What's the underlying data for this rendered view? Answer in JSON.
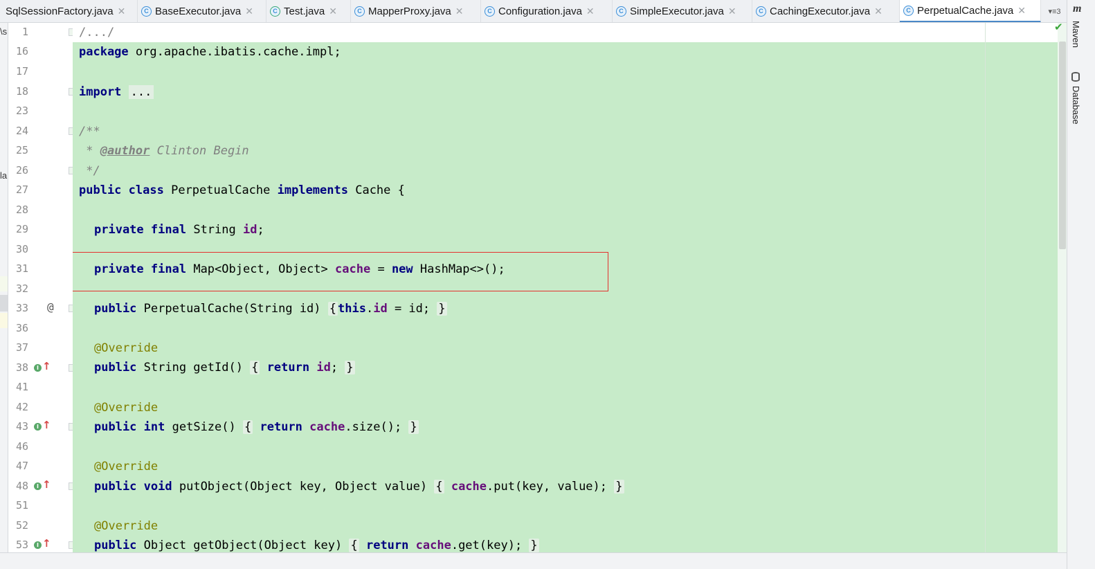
{
  "tabs": [
    {
      "label": "SqlSessionFactory.java",
      "icon": "class-icon",
      "active": false
    },
    {
      "label": "BaseExecutor.java",
      "icon": "class-icon",
      "active": false
    },
    {
      "label": "Test.java",
      "icon": "runnable-class-icon",
      "active": false
    },
    {
      "label": "MapperProxy.java",
      "icon": "class-icon",
      "active": false
    },
    {
      "label": "Configuration.java",
      "icon": "class-icon",
      "active": false
    },
    {
      "label": "SimpleExecutor.java",
      "icon": "class-icon",
      "active": false
    },
    {
      "label": "CachingExecutor.java",
      "icon": "class-icon",
      "active": false
    },
    {
      "label": "PerpetualCache.java",
      "icon": "class-icon",
      "active": true
    }
  ],
  "tab_overflow": {
    "label": "▾≡3"
  },
  "left_strip": {
    "text1": "\\s",
    "text2": "la"
  },
  "gutter": {
    "line_numbers": [
      "1",
      "16",
      "17",
      "18",
      "23",
      "24",
      "25",
      "26",
      "27",
      "28",
      "29",
      "30",
      "31",
      "32",
      "33",
      "36",
      "37",
      "38",
      "41",
      "42",
      "43",
      "46",
      "47",
      "48",
      "51",
      "52",
      "53"
    ],
    "at_marker": "@"
  },
  "code": {
    "l1": "/.../",
    "l16_kw": "package",
    "l16_rest": " org.apache.ibatis.cache.impl;",
    "l18_kw": "import",
    "l18_rest": "...",
    "l24": "/**",
    "l25_star": " * ",
    "l25_tag": "@author",
    "l25_rest": " Clinton Begin",
    "l26": " */",
    "l27_kw1": "public",
    "l27_kw2": "class",
    "l27_name": " PerpetualCache ",
    "l27_kw3": "implements",
    "l27_rest": " Cache {",
    "l29_kw1": "private",
    "l29_kw2": "final",
    "l29_type": " String ",
    "l29_field": "id",
    "l29_end": ";",
    "l31_kw1": "private",
    "l31_kw2": "final",
    "l31_type": " Map<Object, Object> ",
    "l31_field": "cache",
    "l31_eq": " = ",
    "l31_kw3": "new",
    "l31_rest": " HashMap<>();",
    "l33_kw": "public",
    "l33_sig": " PerpetualCache(String id) ",
    "l33_open": "{",
    "l33_kw2": "this",
    "l33_dot": ".",
    "l33_field": "id",
    "l33_rest": " = id; ",
    "l33_close": "}",
    "override": "@Override",
    "l38_kw": "public",
    "l38_sig": " String getId() ",
    "l38_open": "{",
    "l38_kw2": "return",
    "l38_field": "id",
    "l38_end": ";",
    "l38_close": "}",
    "l43_kw": "public",
    "l43_kw2": "int",
    "l43_sig": " getSize() ",
    "l43_open": "{",
    "l43_kw3": "return",
    "l43_field": "cache",
    "l43_rest": ".size(); ",
    "l43_close": "}",
    "l48_kw": "public",
    "l48_kw2": "void",
    "l48_sig": " putObject(Object key, Object value) ",
    "l48_open": "{",
    "l48_field": "cache",
    "l48_rest": ".put(key, value); ",
    "l48_close": "}",
    "l53_kw": "public",
    "l53_sig": " Object getObject(Object key) ",
    "l53_open": "{",
    "l53_kw2": "return",
    "l53_field": "cache",
    "l53_rest": ".get(key); ",
    "l53_close": "}"
  },
  "right_strip": {
    "maven": "Maven",
    "maven_icon": "m",
    "database": "Database"
  },
  "colors": {
    "diff_added": "#c7ebc9",
    "highlight_box": "#e4312e",
    "keyword": "#000080",
    "field": "#660e7a",
    "annotation": "#808000"
  }
}
